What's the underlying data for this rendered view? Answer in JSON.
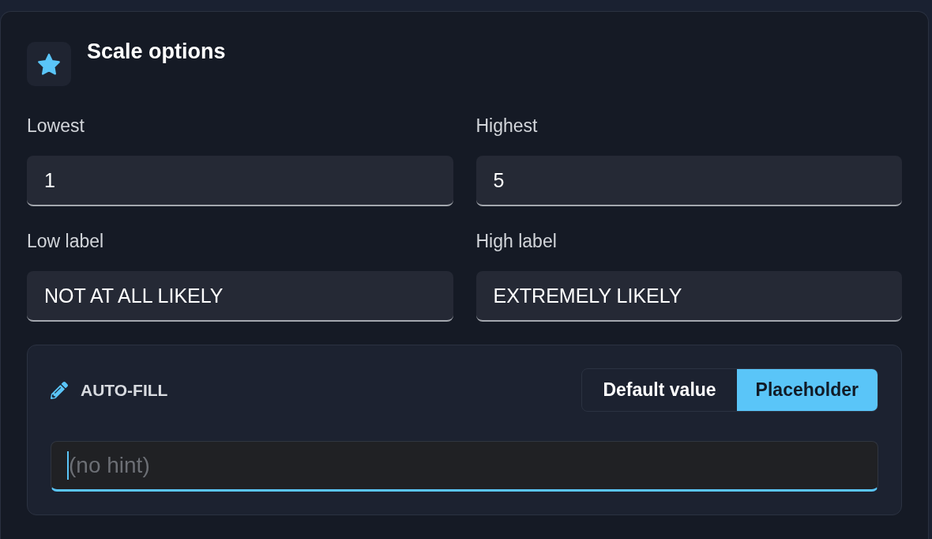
{
  "header": {
    "title": "Scale options"
  },
  "fields": [
    {
      "label": "Lowest",
      "value": "1"
    },
    {
      "label": "Highest",
      "value": "5"
    },
    {
      "label": "Low label",
      "value": "NOT AT ALL LIKELY"
    },
    {
      "label": "High label",
      "value": "EXTREMELY LIKELY"
    }
  ],
  "auto_fill": {
    "title": "AUTO-FILL",
    "modes": [
      {
        "label": "Default value",
        "selected": false
      },
      {
        "label": "Placeholder",
        "selected": true
      }
    ],
    "input": {
      "placeholder": "(no hint)",
      "focused": true
    }
  }
}
